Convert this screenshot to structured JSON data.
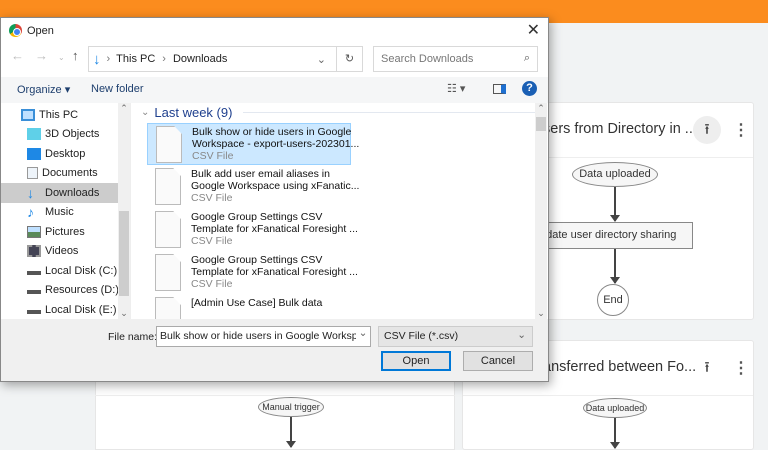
{
  "background": {
    "cards": [
      {
        "title": "sers from Directory in ...",
        "nodes": [
          "Data uploaded",
          "pdate user directory sharing",
          "End"
        ]
      },
      {
        "title": "ansferred between Fo...",
        "nodes": [
          "Data uploaded"
        ]
      },
      {
        "title": "",
        "nodes": [
          "Manual trigger"
        ]
      }
    ]
  },
  "dialog": {
    "title": "Open",
    "close": "✕",
    "breadcrumb": [
      "This PC",
      "Downloads"
    ],
    "search_placeholder": "Search Downloads",
    "toolbar": {
      "organize": "Organize ▾",
      "new_folder": "New folder"
    },
    "nav_pane": [
      {
        "label": "This PC",
        "icon": "monitor-icon"
      },
      {
        "label": "3D Objects",
        "icon": "cube-icon"
      },
      {
        "label": "Desktop",
        "icon": "desktop-icon"
      },
      {
        "label": "Documents",
        "icon": "documents-icon"
      },
      {
        "label": "Downloads",
        "icon": "download-icon",
        "selected": true
      },
      {
        "label": "Music",
        "icon": "music-icon"
      },
      {
        "label": "Pictures",
        "icon": "pictures-icon"
      },
      {
        "label": "Videos",
        "icon": "videos-icon"
      },
      {
        "label": "Local Disk (C:)",
        "icon": "drive-icon"
      },
      {
        "label": "Resources (D:)",
        "icon": "drive-icon"
      },
      {
        "label": "Local Disk (E:)",
        "icon": "drive-icon"
      }
    ],
    "group": "Last week (9)",
    "files": [
      {
        "name1": "Bulk show or hide users in Google",
        "name2": "Workspace - export-users-202301...",
        "type": "CSV File"
      },
      {
        "name1": "Bulk add user email aliases in",
        "name2": "Google Workspace using xFanatic...",
        "type": "CSV File"
      },
      {
        "name1": "Google Group Settings CSV",
        "name2": "Template for xFanatical Foresight ...",
        "type": "CSV File"
      },
      {
        "name1": "Google Group Settings CSV",
        "name2": "Template for xFanatical Foresight ...",
        "type": "CSV File"
      },
      {
        "name1": "[Admin Use Case] Bulk data",
        "name2": "",
        "type": ""
      }
    ],
    "file_name_label": "File name:",
    "file_name_value": "Bulk show or hide users in Google Workspace",
    "file_type": "CSV File (*.csv)",
    "open": "Open",
    "cancel": "Cancel"
  }
}
